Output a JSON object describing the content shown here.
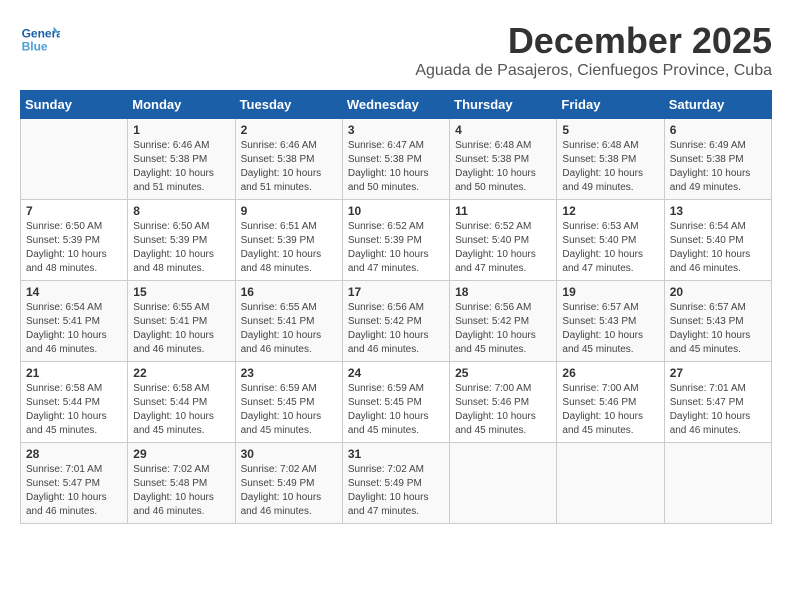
{
  "logo": {
    "line1": "General",
    "line2": "Blue"
  },
  "title": "December 2025",
  "location": "Aguada de Pasajeros, Cienfuegos Province, Cuba",
  "days_of_week": [
    "Sunday",
    "Monday",
    "Tuesday",
    "Wednesday",
    "Thursday",
    "Friday",
    "Saturday"
  ],
  "weeks": [
    [
      {
        "day": "",
        "info": ""
      },
      {
        "day": "1",
        "info": "Sunrise: 6:46 AM\nSunset: 5:38 PM\nDaylight: 10 hours\nand 51 minutes."
      },
      {
        "day": "2",
        "info": "Sunrise: 6:46 AM\nSunset: 5:38 PM\nDaylight: 10 hours\nand 51 minutes."
      },
      {
        "day": "3",
        "info": "Sunrise: 6:47 AM\nSunset: 5:38 PM\nDaylight: 10 hours\nand 50 minutes."
      },
      {
        "day": "4",
        "info": "Sunrise: 6:48 AM\nSunset: 5:38 PM\nDaylight: 10 hours\nand 50 minutes."
      },
      {
        "day": "5",
        "info": "Sunrise: 6:48 AM\nSunset: 5:38 PM\nDaylight: 10 hours\nand 49 minutes."
      },
      {
        "day": "6",
        "info": "Sunrise: 6:49 AM\nSunset: 5:38 PM\nDaylight: 10 hours\nand 49 minutes."
      }
    ],
    [
      {
        "day": "7",
        "info": "Sunrise: 6:50 AM\nSunset: 5:39 PM\nDaylight: 10 hours\nand 48 minutes."
      },
      {
        "day": "8",
        "info": "Sunrise: 6:50 AM\nSunset: 5:39 PM\nDaylight: 10 hours\nand 48 minutes."
      },
      {
        "day": "9",
        "info": "Sunrise: 6:51 AM\nSunset: 5:39 PM\nDaylight: 10 hours\nand 48 minutes."
      },
      {
        "day": "10",
        "info": "Sunrise: 6:52 AM\nSunset: 5:39 PM\nDaylight: 10 hours\nand 47 minutes."
      },
      {
        "day": "11",
        "info": "Sunrise: 6:52 AM\nSunset: 5:40 PM\nDaylight: 10 hours\nand 47 minutes."
      },
      {
        "day": "12",
        "info": "Sunrise: 6:53 AM\nSunset: 5:40 PM\nDaylight: 10 hours\nand 47 minutes."
      },
      {
        "day": "13",
        "info": "Sunrise: 6:54 AM\nSunset: 5:40 PM\nDaylight: 10 hours\nand 46 minutes."
      }
    ],
    [
      {
        "day": "14",
        "info": "Sunrise: 6:54 AM\nSunset: 5:41 PM\nDaylight: 10 hours\nand 46 minutes."
      },
      {
        "day": "15",
        "info": "Sunrise: 6:55 AM\nSunset: 5:41 PM\nDaylight: 10 hours\nand 46 minutes."
      },
      {
        "day": "16",
        "info": "Sunrise: 6:55 AM\nSunset: 5:41 PM\nDaylight: 10 hours\nand 46 minutes."
      },
      {
        "day": "17",
        "info": "Sunrise: 6:56 AM\nSunset: 5:42 PM\nDaylight: 10 hours\nand 46 minutes."
      },
      {
        "day": "18",
        "info": "Sunrise: 6:56 AM\nSunset: 5:42 PM\nDaylight: 10 hours\nand 45 minutes."
      },
      {
        "day": "19",
        "info": "Sunrise: 6:57 AM\nSunset: 5:43 PM\nDaylight: 10 hours\nand 45 minutes."
      },
      {
        "day": "20",
        "info": "Sunrise: 6:57 AM\nSunset: 5:43 PM\nDaylight: 10 hours\nand 45 minutes."
      }
    ],
    [
      {
        "day": "21",
        "info": "Sunrise: 6:58 AM\nSunset: 5:44 PM\nDaylight: 10 hours\nand 45 minutes."
      },
      {
        "day": "22",
        "info": "Sunrise: 6:58 AM\nSunset: 5:44 PM\nDaylight: 10 hours\nand 45 minutes."
      },
      {
        "day": "23",
        "info": "Sunrise: 6:59 AM\nSunset: 5:45 PM\nDaylight: 10 hours\nand 45 minutes."
      },
      {
        "day": "24",
        "info": "Sunrise: 6:59 AM\nSunset: 5:45 PM\nDaylight: 10 hours\nand 45 minutes."
      },
      {
        "day": "25",
        "info": "Sunrise: 7:00 AM\nSunset: 5:46 PM\nDaylight: 10 hours\nand 45 minutes."
      },
      {
        "day": "26",
        "info": "Sunrise: 7:00 AM\nSunset: 5:46 PM\nDaylight: 10 hours\nand 45 minutes."
      },
      {
        "day": "27",
        "info": "Sunrise: 7:01 AM\nSunset: 5:47 PM\nDaylight: 10 hours\nand 46 minutes."
      }
    ],
    [
      {
        "day": "28",
        "info": "Sunrise: 7:01 AM\nSunset: 5:47 PM\nDaylight: 10 hours\nand 46 minutes."
      },
      {
        "day": "29",
        "info": "Sunrise: 7:02 AM\nSunset: 5:48 PM\nDaylight: 10 hours\nand 46 minutes."
      },
      {
        "day": "30",
        "info": "Sunrise: 7:02 AM\nSunset: 5:49 PM\nDaylight: 10 hours\nand 46 minutes."
      },
      {
        "day": "31",
        "info": "Sunrise: 7:02 AM\nSunset: 5:49 PM\nDaylight: 10 hours\nand 47 minutes."
      },
      {
        "day": "",
        "info": ""
      },
      {
        "day": "",
        "info": ""
      },
      {
        "day": "",
        "info": ""
      }
    ]
  ]
}
